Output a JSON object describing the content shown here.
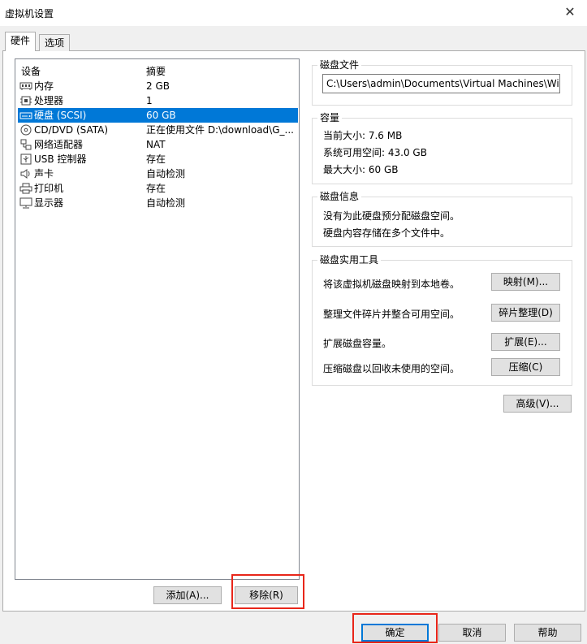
{
  "window": {
    "title": "虚拟机设置",
    "close_glyph": "✕"
  },
  "tabs": [
    {
      "label": "硬件"
    },
    {
      "label": "选项"
    }
  ],
  "device_list": {
    "columns": {
      "device": "设备",
      "summary": "摘要"
    },
    "items": [
      {
        "icon": "memory-icon",
        "device": "内存",
        "summary": "2 GB"
      },
      {
        "icon": "cpu-icon",
        "device": "处理器",
        "summary": "1"
      },
      {
        "icon": "hard-disk-icon",
        "device": "硬盘 (SCSI)",
        "summary": "60 GB",
        "selected": true
      },
      {
        "icon": "cd-dvd-icon",
        "device": "CD/DVD (SATA)",
        "summary": "正在使用文件 D:\\download\\G_..."
      },
      {
        "icon": "network-adapter-icon",
        "device": "网络适配器",
        "summary": "NAT"
      },
      {
        "icon": "usb-icon",
        "device": "USB 控制器",
        "summary": "存在"
      },
      {
        "icon": "sound-card-icon",
        "device": "声卡",
        "summary": "自动检测"
      },
      {
        "icon": "printer-icon",
        "device": "打印机",
        "summary": "存在"
      },
      {
        "icon": "display-icon",
        "device": "显示器",
        "summary": "自动检测"
      }
    ]
  },
  "list_buttons": {
    "add": "添加(A)...",
    "remove": "移除(R)"
  },
  "disk_file": {
    "title": "磁盘文件",
    "path": "C:\\Users\\admin\\Documents\\Virtual Machines\\Window"
  },
  "capacity": {
    "title": "容量",
    "current_size": "当前大小: 7.6 MB",
    "system_free": "系统可用空间: 43.0 GB",
    "max_size": "最大大小: 60 GB"
  },
  "disk_info": {
    "title": "磁盘信息",
    "line1": "没有为此硬盘预分配磁盘空间。",
    "line2": "硬盘内容存储在多个文件中。"
  },
  "disk_utilities": {
    "title": "磁盘实用工具",
    "map_desc": "将该虚拟机磁盘映射到本地卷。",
    "map_button": "映射(M)...",
    "defrag_desc": "整理文件碎片并整合可用空间。",
    "defrag_button": "碎片整理(D)",
    "expand_desc": "扩展磁盘容量。",
    "expand_button": "扩展(E)...",
    "compact_desc": "压缩磁盘以回收未使用的空间。",
    "compact_button": "压缩(C)"
  },
  "advanced_button": "高级(V)...",
  "footer": {
    "ok": "确定",
    "cancel": "取消",
    "help": "帮助"
  },
  "colors": {
    "selection": "#0078d7",
    "highlight_box": "#e8261a"
  }
}
